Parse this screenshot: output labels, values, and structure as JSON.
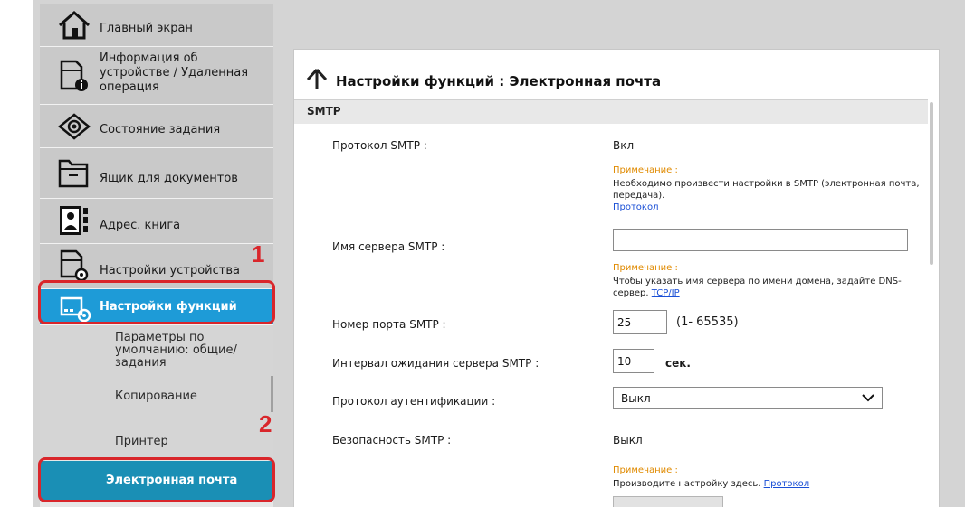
{
  "sidebar": {
    "items": [
      {
        "label": "Главный экран",
        "icon": "home-icon"
      },
      {
        "label": "Информация об устройстве / Удаленная операция",
        "icon": "device-info-icon"
      },
      {
        "label": "Состояние задания",
        "icon": "eye-icon"
      },
      {
        "label": "Ящик для документов",
        "icon": "folder-icon"
      },
      {
        "label": "Адрес. книга",
        "icon": "address-book-icon"
      },
      {
        "label": "Настройки устройства",
        "icon": "device-settings-icon"
      },
      {
        "label": "Настройки функций",
        "icon": "function-settings-icon"
      }
    ],
    "subitems": [
      {
        "label": "Параметры по умолчанию: общие/задания"
      },
      {
        "label": "Копирование"
      },
      {
        "label": "Принтер"
      },
      {
        "label": "Электронная почта"
      }
    ],
    "step1": "1",
    "step2": "2"
  },
  "main": {
    "title": "Настройки функций : Электронная почта",
    "section": "SMTP",
    "rows": {
      "smtp_protocol": {
        "label": "Протокол SMTP :",
        "value": "Вкл"
      },
      "note1": {
        "heading": "Примечание :",
        "text": "Необходимо произвести настройки в SMTP (электронная почта, передача).",
        "link": "Протокол"
      },
      "server_name": {
        "label": "Имя сервера SMTP :",
        "value": ""
      },
      "note2": {
        "heading": "Примечание :",
        "text": "Чтобы указать имя сервера по имени домена, задайте DNS-сервер.",
        "link": "TCP/IP"
      },
      "port": {
        "label": "Номер порта SMTP :",
        "value": "25",
        "range": "(1- 65535)"
      },
      "timeout": {
        "label": "Интервал ожидания сервера SMTP :",
        "value": "10",
        "unit": "сек."
      },
      "auth": {
        "label": "Протокол аутентификации :",
        "value": "Выкл"
      },
      "security": {
        "label": "Безопасность SMTP :",
        "value": "Выкл"
      },
      "note3": {
        "heading": "Примечание :",
        "text": "Производите настройку здесь.",
        "link": "Протокол"
      }
    }
  },
  "colors": {
    "active_blue": "#1e9bd7",
    "active_sub": "#1a8fb5",
    "callout_red": "#d9262b",
    "note_orange": "#e08a00",
    "link_blue": "#1a4fd6"
  }
}
